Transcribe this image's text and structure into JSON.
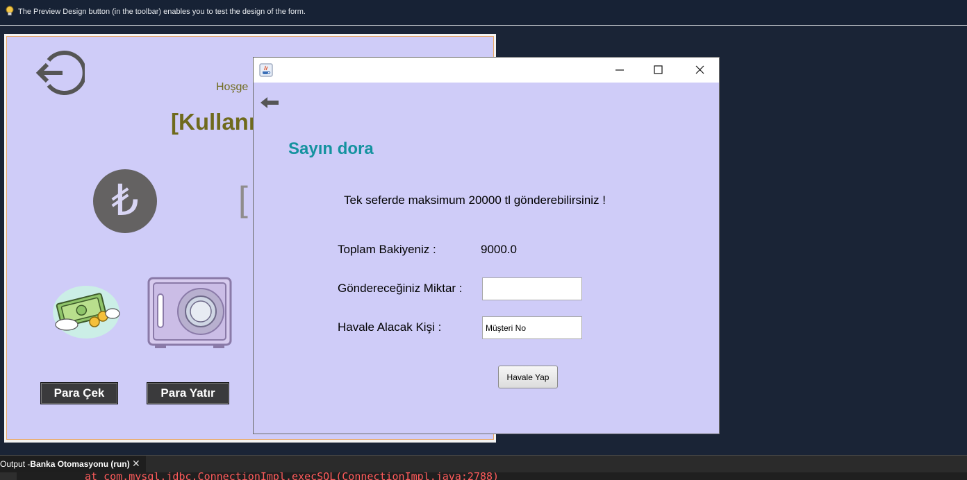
{
  "ide": {
    "hint_text": "The Preview Design button (in the toolbar) enables you to test the design of the form.",
    "output_tab_prefix": "Output - ",
    "output_tab_name": "Banka Otomasyonu (run)",
    "output_tab_close": "✕",
    "output_line": "at com.mysql.jdbc.ConnectionImpl.execSQL(ConnectionImpl.java:2788)"
  },
  "designer_form": {
    "welcome_partial": "Hoşge",
    "username_partial": "[Kullanı",
    "lira_symbol": "₺",
    "bracket_partial": "[",
    "withdraw_button": "Para Çek",
    "deposit_button": "Para Yatır"
  },
  "transfer_window": {
    "greeting": "Sayın dora",
    "limit_notice": "Tek seferde maksimum 20000 tl gönderebilirsiniz !",
    "balance_label": "Toplam Bakiyeniz :",
    "balance_value": "9000.0",
    "amount_label": "Göndereceğiniz Miktar :",
    "amount_value": "",
    "recipient_label": "Havale Alacak Kişi :",
    "recipient_value": "Müşteri No",
    "transfer_button": "Havale Yap"
  },
  "colors": {
    "form_background": "#cfccf8",
    "greeting_color": "#14929f",
    "title_color": "#6f6a1d",
    "ide_background": "#1a2436"
  }
}
